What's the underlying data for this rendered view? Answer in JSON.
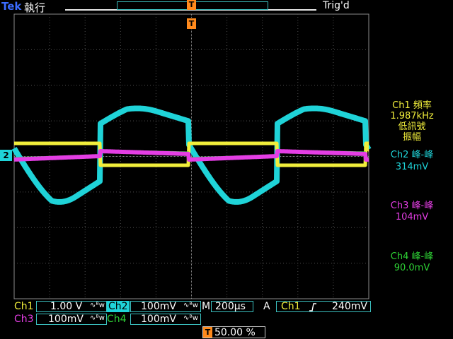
{
  "header": {
    "brand": "Tek",
    "mode": "執行",
    "trigger_state": "Trig'd",
    "trigger_marker": "T"
  },
  "measurements": {
    "ch1_label": "Ch1 頻率",
    "ch1_value": "1.987kHz",
    "ch1_note_1": "低訊號",
    "ch1_note_2": "振幅",
    "ch2_label": "Ch2 峰-峰",
    "ch2_value": "314mV",
    "ch3_label": "Ch3 峰-峰",
    "ch3_value": "104mV",
    "ch4_label": "Ch4 峰-峰",
    "ch4_value": "90.0mV"
  },
  "channels": {
    "ch1": {
      "name": "Ch1",
      "scale": "1.00 V",
      "color": "#f1ee3b"
    },
    "ch2": {
      "name": "Ch2",
      "scale": "100mV",
      "color": "#1fd3d8"
    },
    "ch3": {
      "name": "Ch3",
      "scale": "100mV",
      "color": "#e43ee4"
    },
    "ch4": {
      "name": "Ch4",
      "scale": "100mV",
      "color": "#2ed135"
    },
    "bw_icon": "∿ᴮw"
  },
  "timebase": {
    "mode": "M",
    "scale": "200µs",
    "trigger_type": "A",
    "trigger_source": "Ch1",
    "trigger_slope": "rising-edge-icon",
    "trigger_level": "240mV",
    "position": "50.00 %"
  },
  "ground_marker": "2"
}
